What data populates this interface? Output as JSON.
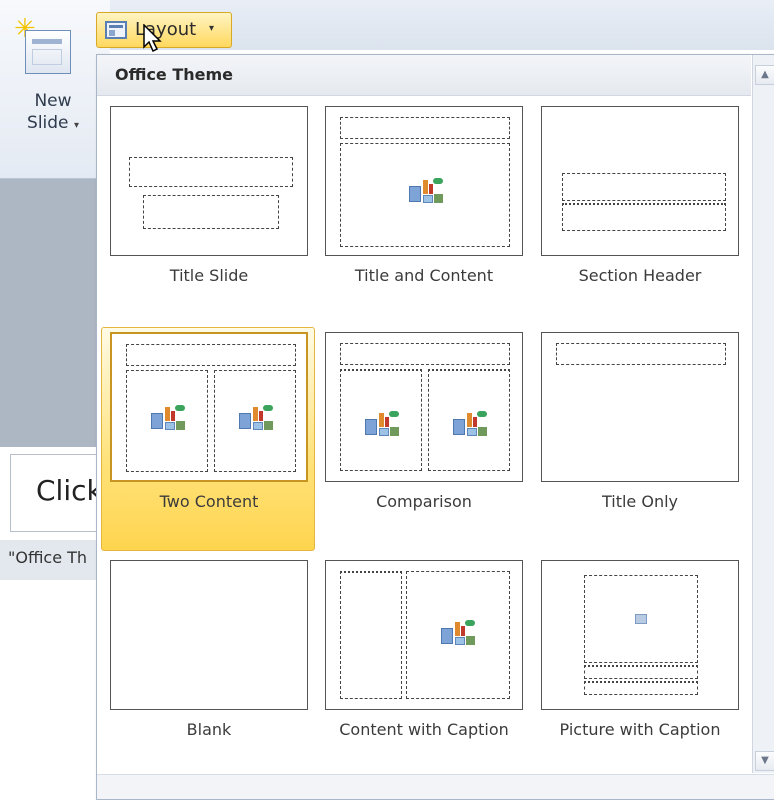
{
  "ribbon": {
    "new_slide_line1": "New",
    "new_slide_line2": "Slide",
    "layout_button": "Layout",
    "layout_caret": "▾"
  },
  "background": {
    "click_text": "Click",
    "status_text": "\"Office Th"
  },
  "gallery": {
    "title": "Office Theme",
    "layouts": [
      {
        "label": "Title Slide"
      },
      {
        "label": "Title and Content"
      },
      {
        "label": "Section Header"
      },
      {
        "label": "Two Content",
        "selected": true
      },
      {
        "label": "Comparison"
      },
      {
        "label": "Title Only"
      },
      {
        "label": "Blank"
      },
      {
        "label": "Content with Caption"
      },
      {
        "label": "Picture with Caption"
      }
    ]
  },
  "icons": {
    "layout": "layout-icon",
    "content_placeholder": "content-placeholder-icon",
    "scroll_up": "▲",
    "scroll_down": "▼"
  },
  "colors": {
    "selected_fill": "#ffd54f",
    "selected_border": "#e4b640",
    "panel_border": "#a9b6c8"
  }
}
